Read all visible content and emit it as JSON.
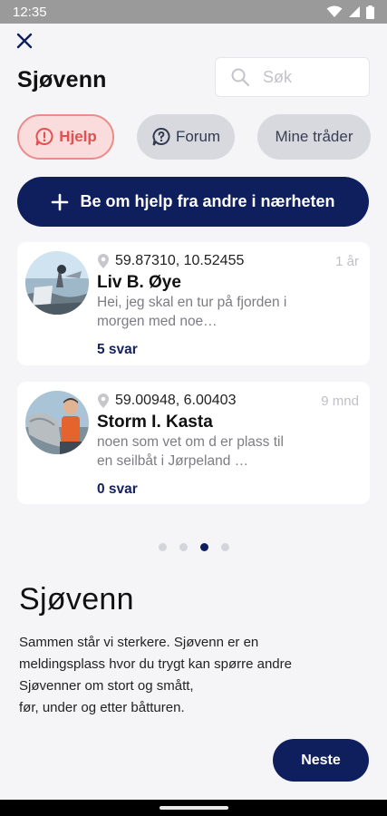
{
  "status_bar": {
    "time": "12:35"
  },
  "header": {
    "title": "Sjøvenn"
  },
  "search": {
    "placeholder": "Søk"
  },
  "tabs": [
    {
      "label": "Hjelp",
      "icon": "alert-chat-icon",
      "active": true
    },
    {
      "label": "Forum",
      "icon": "question-chat-icon",
      "active": false
    },
    {
      "label": "Mine tråder",
      "active": false
    }
  ],
  "cta": {
    "label": "Be om hjelp fra andre i nærheten",
    "icon": "plus-icon"
  },
  "posts": [
    {
      "coords": "59.87310, 10.52455",
      "age": "1 år",
      "name": "Liv B. Øye",
      "message": "Hei, jeg skal en tur på fjorden i morgen med noe…",
      "replies": "5 svar"
    },
    {
      "coords": "59.00948, 6.00403",
      "age": "9 mnd",
      "name": "Storm I. Kasta",
      "message": "noen som vet om d er plass til en seilbåt i Jørpeland …",
      "replies": "0 svar"
    }
  ],
  "pager": {
    "total": 4,
    "active_index": 2
  },
  "onboarding": {
    "title": "Sjøvenn",
    "text_lines": [
      "Sammen står vi sterkere. Sjøvenn er en",
      "meldingsplass hvor du trygt kan spørre andre",
      "Sjøvenner om stort og smått,",
      "før, under og etter båtturen."
    ],
    "next_label": "Neste"
  },
  "colors": {
    "brand_navy": "#0f1f5e",
    "active_tab_bg": "#fbdcdc",
    "active_tab_text": "#e2504f",
    "inactive_tab_bg": "#d7d9de"
  }
}
